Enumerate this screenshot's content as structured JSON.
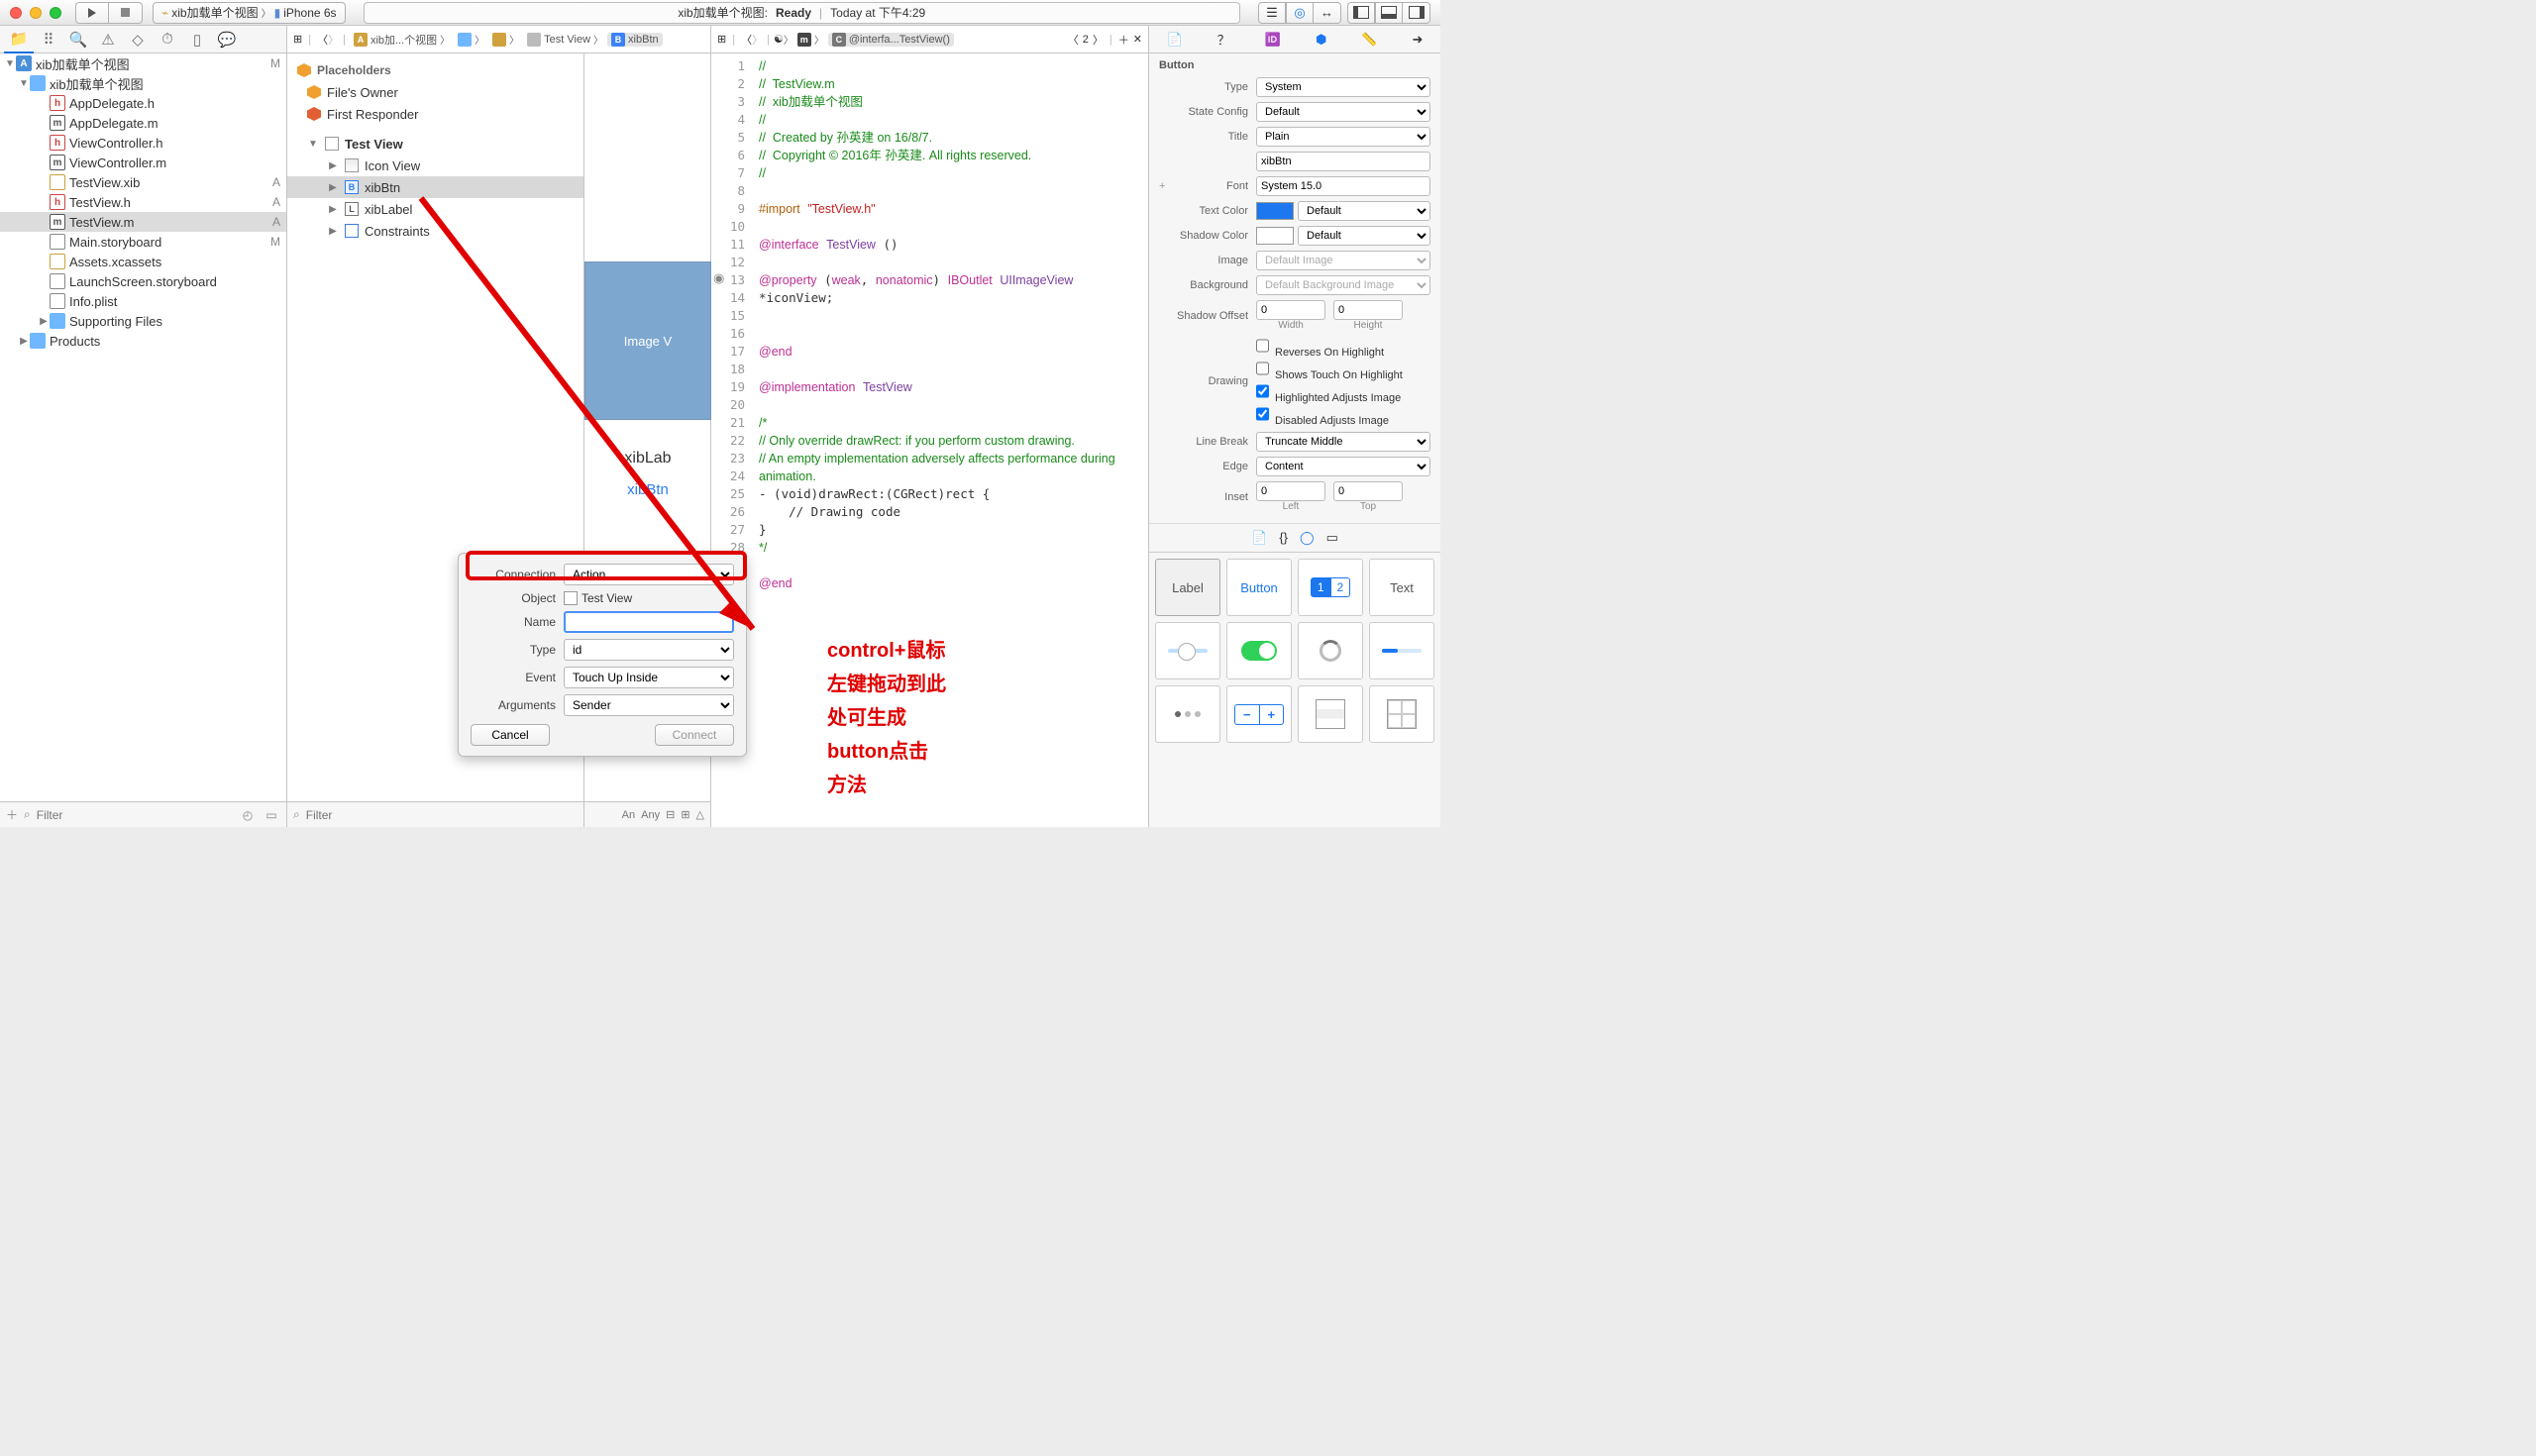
{
  "titlebar": {
    "scheme_app": "xib加载单个视图",
    "scheme_device": "iPhone 6s",
    "status_left": "xib加载单个视图:",
    "status_state": "Ready",
    "status_right": "Today at 下午4:29"
  },
  "jump_left": {
    "crumb1": "xib加...个视图",
    "crumb2_icon": "📁",
    "crumb3_icon": "📄",
    "crumb4": "Test View",
    "crumb5": "xibBtn"
  },
  "jump_right": {
    "crumb1_icon": "m",
    "crumb2": "@interfa...TestView()",
    "counter": "2"
  },
  "navigator": {
    "project": "xib加载单个视图",
    "project_flag": "M",
    "group": "xib加载单个视图",
    "files": [
      {
        "name": "AppDelegate.h",
        "ic": "h",
        "flag": ""
      },
      {
        "name": "AppDelegate.m",
        "ic": "mfile",
        "flag": ""
      },
      {
        "name": "ViewController.h",
        "ic": "h",
        "flag": ""
      },
      {
        "name": "ViewController.m",
        "ic": "mfile",
        "flag": ""
      },
      {
        "name": "TestView.xib",
        "ic": "xibf",
        "flag": "A"
      },
      {
        "name": "TestView.h",
        "ic": "h",
        "flag": "A"
      },
      {
        "name": "TestView.m",
        "ic": "mfile",
        "flag": "A",
        "sel": true
      },
      {
        "name": "Main.storyboard",
        "ic": "sb",
        "flag": "M"
      },
      {
        "name": "Assets.xcassets",
        "ic": "assets",
        "flag": ""
      },
      {
        "name": "LaunchScreen.storyboard",
        "ic": "sb",
        "flag": ""
      },
      {
        "name": "Info.plist",
        "ic": "plist",
        "flag": ""
      }
    ],
    "supporting": "Supporting Files",
    "products": "Products",
    "filter_ph": "Filter"
  },
  "outline": {
    "placeholders": "Placeholders",
    "files_owner": "File's Owner",
    "first_responder": "First Responder",
    "test_view": "Test View",
    "icon_view": "Icon View",
    "xibbtn": "xibBtn",
    "xiblabel": "xibLabel",
    "constraints": "Constraints",
    "filter_ph": "Filter"
  },
  "canvas": {
    "imageview": "Image V",
    "label": "xibLab",
    "button": "xibBtn"
  },
  "code": {
    "lines": [
      "//",
      "//  TestView.m",
      "//  xib加载单个视图",
      "//",
      "//  Created by 孙英建 on 16/8/7.",
      "//  Copyright © 2016年 孙英建. All rights reserved.",
      "//",
      "",
      "#import \"TestView.h\"",
      "",
      "@interface TestView ()",
      "",
      "@property (weak, nonatomic) IBOutlet UIImageView *iconView;",
      "",
      "",
      "@end",
      "",
      "@implementation TestView",
      "",
      "/*",
      "// Only override drawRect: if you perform custom drawing.",
      "// An empty implementation adversely affects performance during animation.",
      "- (void)drawRect:(CGRect)rect {",
      "    // Drawing code",
      "}",
      "*/",
      "",
      "@end",
      ""
    ]
  },
  "popover": {
    "connection_lbl": "Connection",
    "connection_val": "Action",
    "object_lbl": "Object",
    "object_val": "Test View",
    "name_lbl": "Name",
    "name_val": "",
    "type_lbl": "Type",
    "type_val": "id",
    "event_lbl": "Event",
    "event_val": "Touch Up Inside",
    "arguments_lbl": "Arguments",
    "arguments_val": "Sender",
    "cancel": "Cancel",
    "connect": "Connect"
  },
  "annotation": {
    "l1": "control+鼠标",
    "l2": "左键拖动到此",
    "l3": "处可生成",
    "l4": "button点击",
    "l5": "方法"
  },
  "inspector": {
    "title": "Button",
    "type_lbl": "Type",
    "type_val": "System",
    "state_lbl": "State Config",
    "state_val": "Default",
    "titlemode_lbl": "Title",
    "titlemode_val": "Plain",
    "title_txt": "xibBtn",
    "font_lbl": "Font",
    "font_val": "System 15.0",
    "textcolor_lbl": "Text Color",
    "textcolor_val": "Default",
    "textcolor_hex": "#1d77ef",
    "shadowcolor_lbl": "Shadow Color",
    "shadowcolor_val": "Default",
    "shadowcolor_hex": "#ffffff",
    "image_lbl": "Image",
    "image_ph": "Default Image",
    "bg_lbl": "Background",
    "bg_ph": "Default Background Image",
    "shoff_lbl": "Shadow Offset",
    "shoff_w": "0",
    "shoff_h": "0",
    "shoff_wl": "Width",
    "shoff_hl": "Height",
    "drawing_lbl": "Drawing",
    "cb_reverse": "Reverses On Highlight",
    "cb_touch": "Shows Touch On Highlight",
    "cb_hi_img": "Highlighted Adjusts Image",
    "cb_dis_img": "Disabled Adjusts Image",
    "linebreak_lbl": "Line Break",
    "linebreak_val": "Truncate Middle",
    "edge_lbl": "Edge",
    "edge_val": "Content",
    "inset_lbl": "Inset",
    "inset_l": "0",
    "inset_t": "0",
    "inset_ll": "Left",
    "inset_tl": "Top"
  },
  "objlib": {
    "label": "Label",
    "button": "Button",
    "seg1": "1",
    "seg2": "2",
    "text": "Text"
  },
  "canvastools": {
    "any": "An",
    "h": "Any"
  }
}
